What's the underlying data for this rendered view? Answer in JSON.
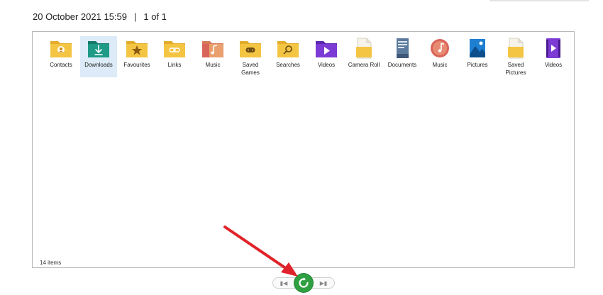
{
  "header": {
    "datetime": "20 October 2021 15:59",
    "separator": "|",
    "page_info": "1 of 1"
  },
  "items": [
    {
      "label": "Contacts",
      "icon": "folder-contacts-icon",
      "selected": false
    },
    {
      "label": "Downloads",
      "icon": "folder-downloads-icon",
      "selected": true
    },
    {
      "label": "Favourites",
      "icon": "folder-favourites-icon",
      "selected": false
    },
    {
      "label": "Links",
      "icon": "folder-links-icon",
      "selected": false
    },
    {
      "label": "Music",
      "icon": "folder-music-icon",
      "selected": false
    },
    {
      "label": "Saved Games",
      "icon": "folder-saved-games-icon",
      "selected": false
    },
    {
      "label": "Searches",
      "icon": "folder-searches-icon",
      "selected": false
    },
    {
      "label": "Videos",
      "icon": "folder-videos-icon",
      "selected": false
    },
    {
      "label": "Camera Roll",
      "icon": "camera-roll-folder-icon",
      "selected": false
    },
    {
      "label": "Documents",
      "icon": "documents-icon",
      "selected": false
    },
    {
      "label": "Music",
      "icon": "music-library-icon",
      "selected": false
    },
    {
      "label": "Pictures",
      "icon": "pictures-icon",
      "selected": false
    },
    {
      "label": "Saved Pictures",
      "icon": "saved-pictures-folder-icon",
      "selected": false
    },
    {
      "label": "Videos",
      "icon": "videos-library-icon",
      "selected": false
    }
  ],
  "status": {
    "item_count": "14 items"
  },
  "nav": {
    "prev_symbol": "▮◀",
    "next_symbol": "▶▮"
  },
  "colors": {
    "folder": "#f4c542",
    "folder_dark": "#e2ac2a",
    "downloads": "#1e9a86",
    "accent_purple": "#7c3bd4",
    "refresh_green": "#2ea041",
    "arrow_red": "#e0232a"
  }
}
